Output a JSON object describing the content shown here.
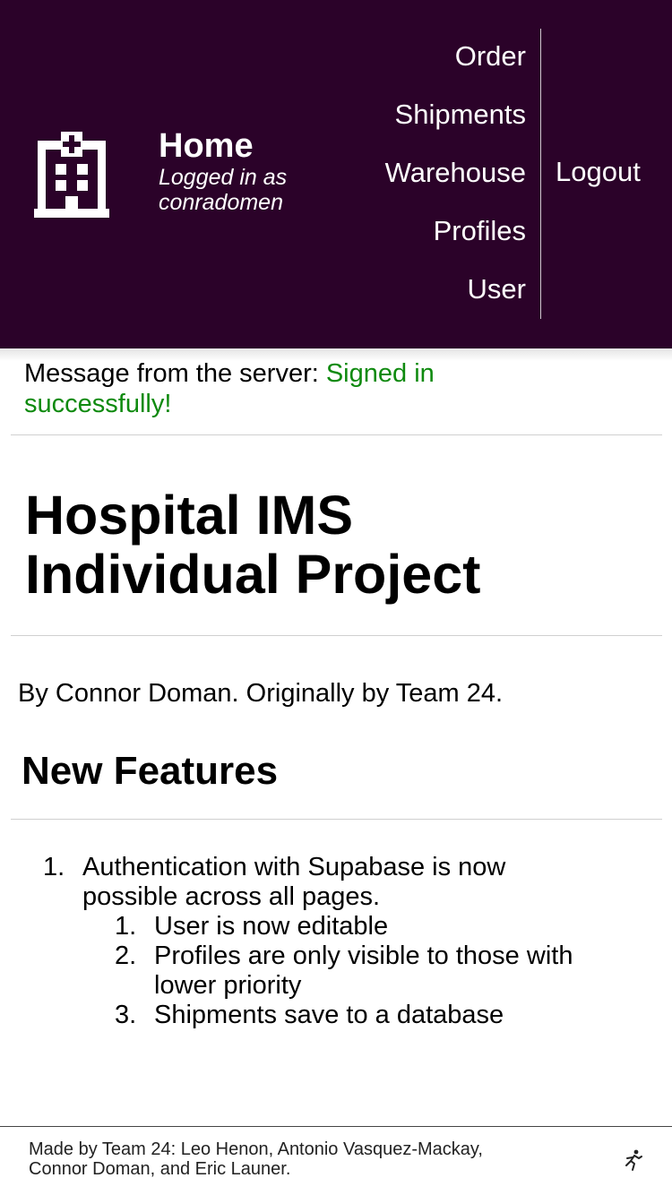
{
  "header": {
    "logo_icon": "hospital-building-icon",
    "title": "Home",
    "subtitle_line1": "Logged in as",
    "subtitle_line2": "conradomen",
    "nav": [
      "Order",
      "Shipments",
      "Warehouse",
      "Profiles",
      "User"
    ],
    "logout": "Logout",
    "background": "#2b0229"
  },
  "message": {
    "prefix": "Message from the server: ",
    "text_line1": "Signed in",
    "text_line2": "successfully!",
    "color": "#0f8a0f"
  },
  "main": {
    "title_line1": "Hospital IMS",
    "title_line2": "Individual Project",
    "byline": "By Connor Doman. Originally by Team 24.",
    "section_title": "New Features",
    "features": [
      {
        "number": "1.",
        "line1": "Authentication with Supabase is now",
        "line2": "possible across all pages.",
        "children": [
          {
            "number": "1.",
            "line1": "User is now editable",
            "line2": ""
          },
          {
            "number": "2.",
            "line1": "Profiles are only visible to those with",
            "line2": "lower priority"
          },
          {
            "number": "3.",
            "line1": "Shipments save to a database",
            "line2": ""
          }
        ]
      }
    ]
  },
  "footer": {
    "line1": "Made by Team 24: Leo Henon, Antonio Vasquez-Mackay,",
    "line2": "Connor Doman, and Eric Launer.",
    "icon": "running-person-icon"
  }
}
